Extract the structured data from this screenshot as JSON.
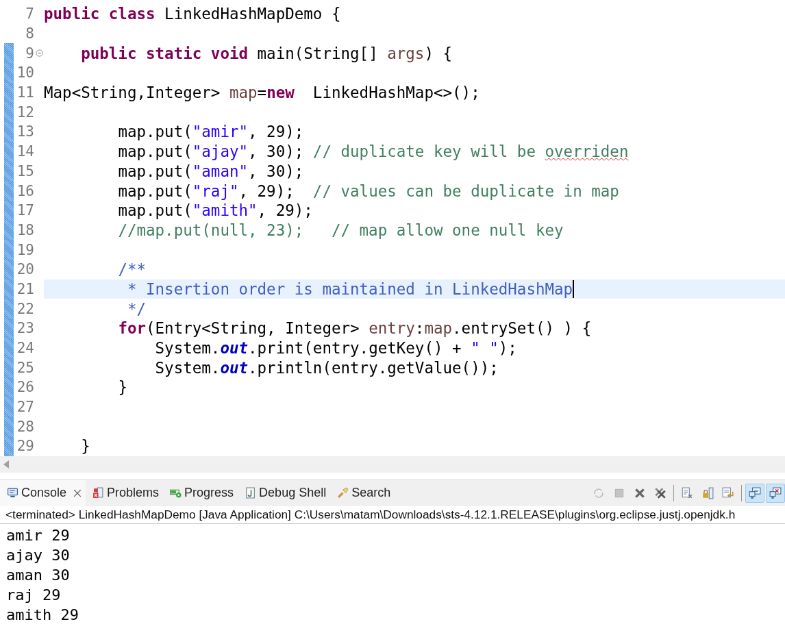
{
  "editor": {
    "lines": [
      {
        "number": "7",
        "changed": false,
        "foldable": false,
        "current": false,
        "tokens": [
          {
            "kind": "keyword",
            "text": "public class "
          },
          {
            "kind": "plain",
            "text": "LinkedHashMapDemo {"
          }
        ]
      },
      {
        "number": "8",
        "changed": false,
        "foldable": false,
        "current": false
      },
      {
        "number": "9",
        "changed": true,
        "foldable": true,
        "current": false,
        "tokens": [
          {
            "kind": "keyword",
            "text": "    public static void "
          },
          {
            "kind": "plain",
            "text": "main(String[] "
          },
          {
            "kind": "local",
            "text": "args"
          },
          {
            "kind": "plain",
            "text": ") {"
          }
        ]
      },
      {
        "number": "10",
        "changed": true,
        "foldable": false,
        "current": false
      },
      {
        "number": "11",
        "changed": true,
        "foldable": false,
        "current": false,
        "tokens": [
          {
            "kind": "plain",
            "text": "Map<String,Integer> "
          },
          {
            "kind": "local",
            "text": "map"
          },
          {
            "kind": "plain",
            "text": "="
          },
          {
            "kind": "keyword",
            "text": "new"
          },
          {
            "kind": "plain",
            "text": "  LinkedHashMap<>();"
          }
        ]
      },
      {
        "number": "12",
        "changed": true,
        "foldable": false,
        "current": false
      },
      {
        "number": "13",
        "changed": true,
        "foldable": false,
        "current": false,
        "tokens": [
          {
            "kind": "plain",
            "text": "        map.put("
          },
          {
            "kind": "string",
            "text": "\"amir\""
          },
          {
            "kind": "plain",
            "text": ", 29);"
          }
        ]
      },
      {
        "number": "14",
        "changed": true,
        "foldable": false,
        "current": false,
        "tokens": [
          {
            "kind": "plain",
            "text": "        map.put("
          },
          {
            "kind": "string",
            "text": "\"ajay\""
          },
          {
            "kind": "plain",
            "text": ", 30); "
          },
          {
            "kind": "comment",
            "text": "// duplicate key will be "
          },
          {
            "kind": "misspelled",
            "text": "overriden"
          }
        ]
      },
      {
        "number": "15",
        "changed": true,
        "foldable": false,
        "current": false,
        "tokens": [
          {
            "kind": "plain",
            "text": "        map.put("
          },
          {
            "kind": "string",
            "text": "\"aman\""
          },
          {
            "kind": "plain",
            "text": ", 30);"
          }
        ]
      },
      {
        "number": "16",
        "changed": true,
        "foldable": false,
        "current": false,
        "tokens": [
          {
            "kind": "plain",
            "text": "        map.put("
          },
          {
            "kind": "string",
            "text": "\"raj\""
          },
          {
            "kind": "plain",
            "text": ", 29);  "
          },
          {
            "kind": "comment",
            "text": "// values can be duplicate in map"
          }
        ]
      },
      {
        "number": "17",
        "changed": true,
        "foldable": false,
        "current": false,
        "tokens": [
          {
            "kind": "plain",
            "text": "        map.put("
          },
          {
            "kind": "string",
            "text": "\"amith\""
          },
          {
            "kind": "plain",
            "text": ", 29);"
          }
        ]
      },
      {
        "number": "18",
        "changed": true,
        "foldable": false,
        "current": false,
        "tokens": [
          {
            "kind": "comment",
            "text": "        //map.put(null, 23);   // map allow one null key"
          }
        ]
      },
      {
        "number": "19",
        "changed": true,
        "foldable": false,
        "current": false
      },
      {
        "number": "20",
        "changed": true,
        "foldable": false,
        "current": false,
        "tokens": [
          {
            "kind": "javadoc",
            "text": "        /**"
          }
        ]
      },
      {
        "number": "21",
        "changed": true,
        "foldable": false,
        "current": true,
        "tokens": [
          {
            "kind": "javadoc",
            "text": "         * Insertion order is maintained in LinkedHashMap"
          }
        ]
      },
      {
        "number": "22",
        "changed": true,
        "foldable": false,
        "current": false,
        "tokens": [
          {
            "kind": "javadoc",
            "text": "         */"
          }
        ]
      },
      {
        "number": "23",
        "changed": true,
        "foldable": false,
        "current": false,
        "tokens": [
          {
            "kind": "keyword",
            "text": "        for"
          },
          {
            "kind": "plain",
            "text": "(Entry<String, Integer> "
          },
          {
            "kind": "local",
            "text": "entry"
          },
          {
            "kind": "plain",
            "text": ":"
          },
          {
            "kind": "local",
            "text": "map"
          },
          {
            "kind": "plain",
            "text": ".entrySet() ) {"
          }
        ]
      },
      {
        "number": "24",
        "changed": true,
        "foldable": false,
        "current": false,
        "tokens": [
          {
            "kind": "plain",
            "text": "            System."
          },
          {
            "kind": "field",
            "text": "out"
          },
          {
            "kind": "plain",
            "text": ".print(entry.getKey() + "
          },
          {
            "kind": "string",
            "text": "\" \""
          },
          {
            "kind": "plain",
            "text": ");"
          }
        ]
      },
      {
        "number": "25",
        "changed": true,
        "foldable": false,
        "current": false,
        "tokens": [
          {
            "kind": "plain",
            "text": "            System."
          },
          {
            "kind": "field",
            "text": "out"
          },
          {
            "kind": "plain",
            "text": ".println(entry.getValue());"
          }
        ]
      },
      {
        "number": "26",
        "changed": true,
        "foldable": false,
        "current": false,
        "tokens": [
          {
            "kind": "plain",
            "text": "        }"
          }
        ]
      },
      {
        "number": "27",
        "changed": true,
        "foldable": false,
        "current": false
      },
      {
        "number": "28",
        "changed": true,
        "foldable": false,
        "current": false
      },
      {
        "number": "29",
        "changed": true,
        "foldable": false,
        "current": false,
        "tokens": [
          {
            "kind": "plain",
            "text": "    }"
          }
        ]
      }
    ]
  },
  "console": {
    "tabs": [
      {
        "label": "Console",
        "selected": true
      },
      {
        "label": "Problems",
        "selected": false
      },
      {
        "label": "Progress",
        "selected": false
      },
      {
        "label": "Debug Shell",
        "selected": false
      },
      {
        "label": "Search",
        "selected": false
      }
    ],
    "toolbar": [
      {
        "kind": "relaunch",
        "disabled": true,
        "on": false
      },
      {
        "kind": "terminate",
        "disabled": true,
        "on": false
      },
      {
        "kind": "remove",
        "disabled": false,
        "on": false
      },
      {
        "kind": "remove-all",
        "disabled": false,
        "on": false
      },
      {
        "kind": "clear",
        "disabled": false,
        "on": false
      },
      {
        "kind": "scroll-lock",
        "disabled": false,
        "on": false
      },
      {
        "kind": "word-wrap",
        "disabled": false,
        "on": false
      },
      {
        "kind": "show-stdout",
        "disabled": false,
        "on": true
      },
      {
        "kind": "show-stderr",
        "disabled": false,
        "on": true
      }
    ],
    "process": "<terminated> LinkedHashMapDemo [Java Application] C:\\Users\\matam\\Downloads\\sts-4.12.1.RELEASE\\plugins\\org.eclipse.justj.openjdk.h",
    "output": [
      "amir 29",
      "ajay 30",
      "aman 30",
      "raj 29",
      "amith 29"
    ]
  }
}
